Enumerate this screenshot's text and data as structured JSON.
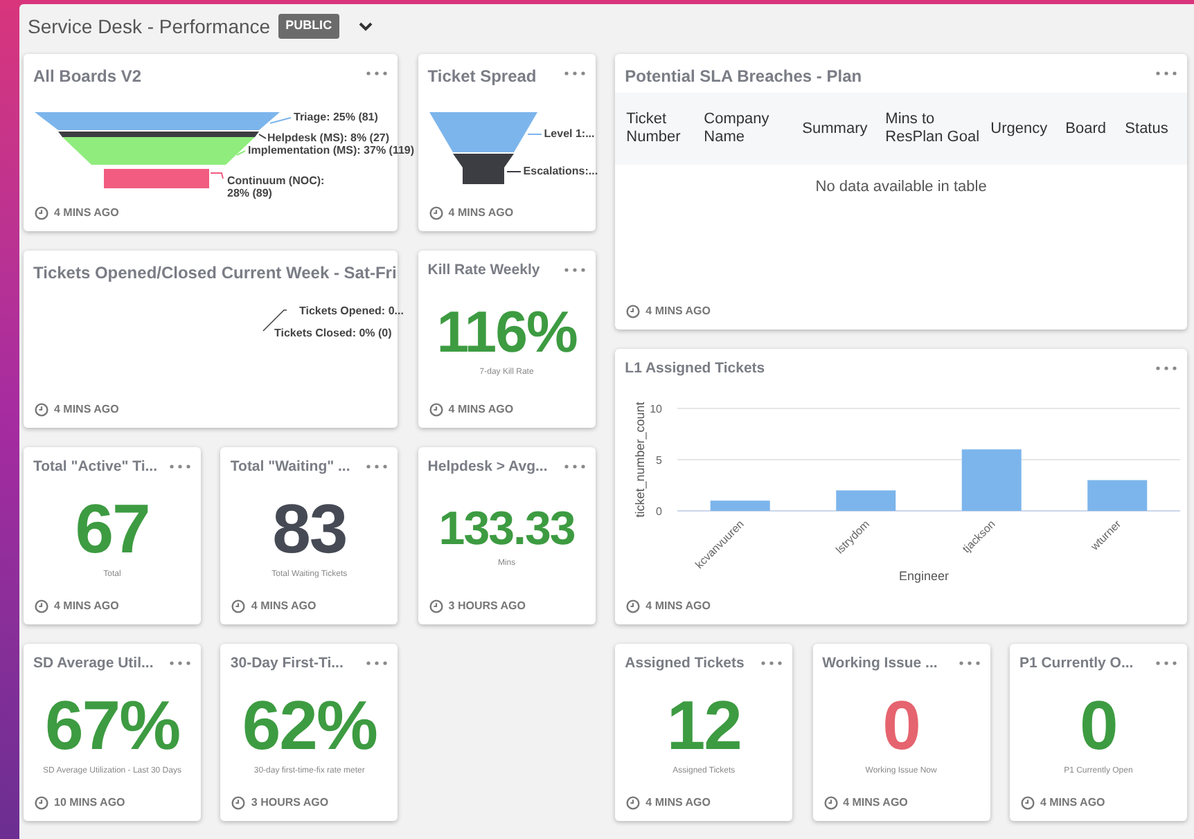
{
  "header": {
    "title": "Service Desk - Performance",
    "badge": "PUBLIC"
  },
  "cards": [
    {
      "kind": "funnel",
      "title": "All Boards V2",
      "updated": "4 MINS AGO",
      "segments": [
        {
          "label": "Triage: 25% (81)",
          "color": "#7cb5ec"
        },
        {
          "label": "Helpdesk (MS): 8% (27)",
          "color": "#3c3d42"
        },
        {
          "label": "Implementation (MS): 37% (119)",
          "color": "#90ed7d"
        },
        {
          "label": "Continuum (NOC): 28% (89)",
          "color": "#f15c80"
        }
      ]
    },
    {
      "kind": "funnel",
      "title": "Ticket Spread",
      "updated": "4 MINS AGO",
      "segments": [
        {
          "label": "Level 1:...",
          "color": "#7cb5ec"
        },
        {
          "label": "Escalations:...",
          "color": "#3c3d42"
        }
      ]
    },
    {
      "kind": "table",
      "title": "Potential SLA Breaches - Plan",
      "updated": "4 MINS AGO",
      "columns": [
        "Ticket Number",
        "Company Name",
        "Summary",
        "Mins to ResPlan Goal",
        "Urgency",
        "Board",
        "Status"
      ],
      "empty_message": "No data available in table"
    },
    {
      "kind": "pie",
      "title": "Tickets Opened/Closed Current Week - Sat-Fri",
      "updated": "4 MINS AGO",
      "labels": [
        "Tickets Opened: 0...",
        "Tickets Closed: 0% (0)"
      ]
    },
    {
      "kind": "stat",
      "title": "Kill Rate Weekly",
      "updated": "4 MINS AGO",
      "value": "116%",
      "caption": "7-day Kill Rate",
      "color": "#3d9b41"
    },
    {
      "kind": "stat",
      "title": "Total \"Active\" Ti...",
      "updated": "4 MINS AGO",
      "value": "67",
      "caption": "Total",
      "color": "#3d9b41"
    },
    {
      "kind": "stat",
      "title": "Total \"Waiting\" ...",
      "updated": "4 MINS AGO",
      "value": "83",
      "caption": "Total Waiting Tickets",
      "color": "#464a55"
    },
    {
      "kind": "stat",
      "title": "Helpdesk > Avg...",
      "updated": "3 HOURS AGO",
      "value": "133.33",
      "caption": "Mins",
      "color": "#3d9b41"
    },
    {
      "kind": "bar",
      "title": "L1 Assigned Tickets",
      "updated": "4 MINS AGO",
      "chart_data": {
        "type": "bar",
        "xlabel": "Engineer",
        "ylabel": "ticket_number_count",
        "categories": [
          "kcvanvuuren",
          "lstrydom",
          "tjackson",
          "wturner"
        ],
        "series": [
          {
            "color": "#7cb5ec",
            "values": [
              1,
              2,
              6,
              3
            ]
          }
        ],
        "ylim": [
          0,
          10
        ],
        "yticks": [
          0,
          5,
          10
        ]
      }
    },
    {
      "kind": "stat",
      "title": "SD Average Util...",
      "updated": "10 MINS AGO",
      "value": "67%",
      "caption": "SD Average Utilization - Last 30 Days",
      "color": "#3d9b41"
    },
    {
      "kind": "stat",
      "title": "30-Day First-Ti...",
      "updated": "3 HOURS AGO",
      "value": "62%",
      "caption": "30-day first-time-fix rate meter",
      "color": "#3d9b41"
    },
    {
      "kind": "stat",
      "title": "Assigned Tickets",
      "updated": "4 MINS AGO",
      "value": "12",
      "caption": "Assigned Tickets",
      "color": "#3d9b41"
    },
    {
      "kind": "stat",
      "title": "Working Issue ...",
      "updated": "4 MINS AGO",
      "value": "0",
      "caption": "Working Issue Now",
      "color": "#e5646f"
    },
    {
      "kind": "stat",
      "title": "P1 Currently O...",
      "updated": "4 MINS AGO",
      "value": "0",
      "caption": "P1 Currently Open",
      "color": "#3d9b41"
    }
  ]
}
